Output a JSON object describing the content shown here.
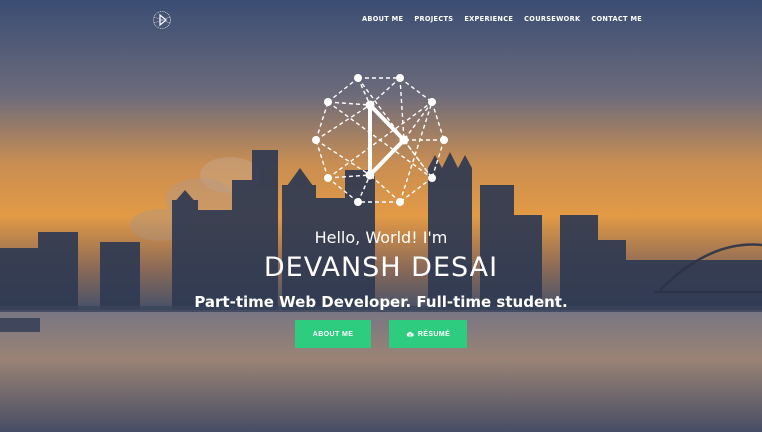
{
  "nav": {
    "logo_icon": "play-network-logo-icon",
    "links": [
      "ABOUT ME",
      "PROJECTS",
      "EXPERIENCE",
      "COURSEWORK",
      "CONTACT ME"
    ]
  },
  "hero": {
    "logo_icon": "play-network-logo-icon",
    "greeting": "Hello, World! I'm",
    "name": "DEVANSH DESAI",
    "tagline": "Part-time Web Developer. Full-time student.",
    "buttons": {
      "about_label": "ABOUT ME",
      "resume_label": "RÉSUMÉ",
      "resume_icon": "cloud-download-icon"
    }
  },
  "colors": {
    "accent": "#2ecc7f",
    "text": "#ffffff"
  }
}
